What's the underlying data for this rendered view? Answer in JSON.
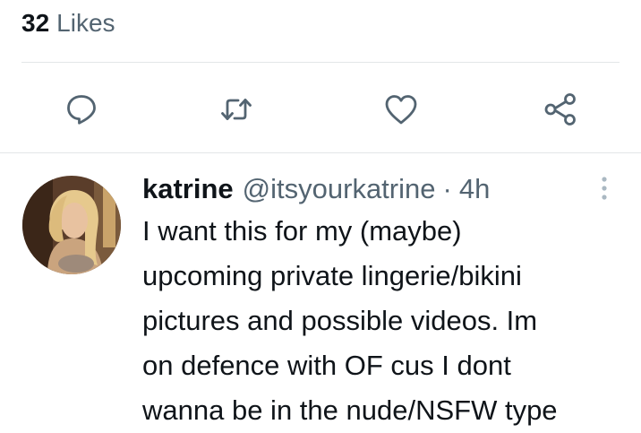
{
  "engagement": {
    "likes_count": "32",
    "likes_label": "Likes"
  },
  "actions": {
    "reply_icon": "reply-bubble-icon",
    "retweet_icon": "retweet-arrows-icon",
    "like_icon": "heart-outline-icon",
    "share_icon": "share-nodes-icon",
    "icon_color": "#536471"
  },
  "reply_tweet": {
    "display_name": "katrine",
    "handle": "@itsyourkatrine",
    "separator": "·",
    "time": "4h",
    "more_icon": "more-vertical-icon",
    "text_lines": [
      "I want this for my (maybe)",
      "upcoming private lingerie/bikini",
      "pictures and possible videos. Im",
      "on defence with OF cus I dont",
      "wanna be in the nude/NSFW type"
    ]
  },
  "colors": {
    "primary_text": "#0f1419",
    "secondary_text": "#536471",
    "divider": "#e3e6e8",
    "background": "#ffffff"
  }
}
